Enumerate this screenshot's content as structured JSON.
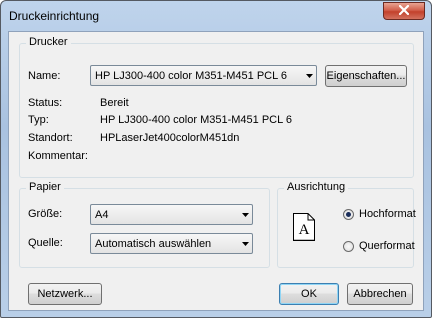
{
  "window": {
    "title": "Druckeinrichtung"
  },
  "printer": {
    "group_label": "Drucker",
    "name_label": "Name:",
    "name_value": "HP LJ300-400 color M351-M451 PCL 6",
    "properties_button": "Eigenschaften...",
    "status_label": "Status:",
    "status_value": "Bereit",
    "type_label": "Typ:",
    "type_value": "HP LJ300-400 color M351-M451 PCL 6",
    "location_label": "Standort:",
    "location_value": "HPLaserJet400colorM451dn",
    "comment_label": "Kommentar:",
    "comment_value": ""
  },
  "paper": {
    "group_label": "Papier",
    "size_label": "Größe:",
    "size_value": "A4",
    "source_label": "Quelle:",
    "source_value": "Automatisch auswählen"
  },
  "orientation": {
    "group_label": "Ausrichtung",
    "icon_letter": "A",
    "portrait_label": "Hochformat",
    "landscape_label": "Querformat",
    "selected": "portrait"
  },
  "buttons": {
    "network": "Netzwerk...",
    "ok": "OK",
    "cancel": "Abbrechen"
  },
  "colors": {
    "title_bar": "#b9cfe8",
    "close_button": "#c2412c",
    "dialog_background": "#f0f0f0"
  }
}
